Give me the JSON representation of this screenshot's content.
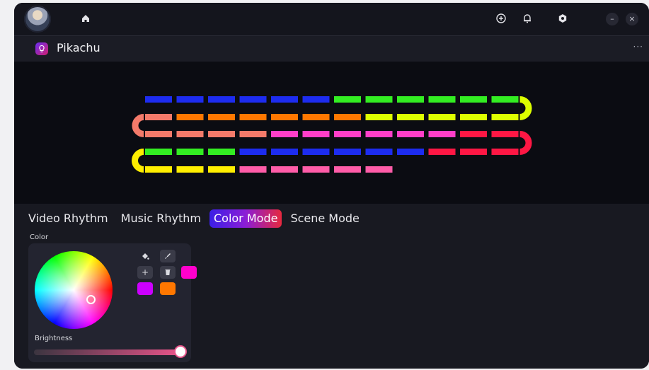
{
  "titlebar": {
    "icons": [
      "home-icon",
      "add-circle-icon",
      "bell-icon",
      "hex-settings-icon",
      "minimize-icon",
      "close-icon"
    ],
    "minimize_glyph": "–",
    "close_glyph": "×"
  },
  "device": {
    "name": "Pikachu",
    "icon": "bulb-icon",
    "more_glyph": "···"
  },
  "tabs": [
    {
      "label": "Video Rhythm",
      "active": false
    },
    {
      "label": "Music Rhythm",
      "active": false
    },
    {
      "label": "Color Mode",
      "active": true
    },
    {
      "label": "Scene Mode",
      "active": false
    }
  ],
  "color_section": {
    "label": "Color",
    "tools": [
      "paint-bucket-icon",
      "brush-icon"
    ],
    "add_glyph": "+",
    "delete_icon": "trash-icon",
    "swatches": [
      "#ff00cc",
      "#cc00ff",
      "#ff7700"
    ],
    "brightness_label": "Brightness",
    "brightness_value": 1.0
  },
  "strip_colors": {
    "blue": "#1d2cf0",
    "green": "#33ee22",
    "yellow": "#ddff00",
    "orange": "#ff7700",
    "salmon": "#f47a6a",
    "pink": "#ff3ec8",
    "red": "#ff1744",
    "rose": "#ff5ca8",
    "yellow2": "#ffee00"
  },
  "strip_rows": [
    [
      "blue",
      "blue",
      "blue",
      "blue",
      "blue",
      "blue",
      "green",
      "green",
      "green",
      "green",
      "green",
      "green"
    ],
    [
      "salmon",
      "orange",
      "orange",
      "orange",
      "orange",
      "orange",
      "orange",
      "yellow",
      "yellow",
      "yellow",
      "yellow",
      "yellow"
    ],
    [
      "salmon",
      "salmon",
      "salmon",
      "salmon",
      "pink",
      "pink",
      "pink",
      "pink",
      "pink",
      "pink",
      "red",
      "red"
    ],
    [
      "green",
      "green",
      "green",
      "blue",
      "blue",
      "blue",
      "blue",
      "blue",
      "blue",
      "red",
      "red",
      "red"
    ],
    [
      "yellow2",
      "yellow2",
      "yellow2",
      "rose",
      "rose",
      "rose",
      "rose",
      "rose",
      "",
      "",
      "",
      ""
    ]
  ],
  "strip_caps": {
    "right_1": "yellow",
    "left_2": "salmon",
    "right_3": "red",
    "left_4": "yellow2"
  }
}
